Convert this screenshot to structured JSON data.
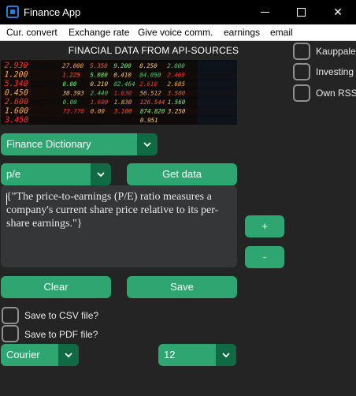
{
  "window": {
    "title": "Finance App",
    "controls": {
      "minimize": "",
      "maximize": "",
      "close": "✕"
    }
  },
  "menu": {
    "items": [
      "Cur. convert",
      "Exchange rate",
      "Give voice comm.",
      "earnings",
      "email"
    ]
  },
  "heading": "FINACIAL DATA FROM API-SOURCES",
  "board": {
    "rows": [
      [
        "2.930",
        "27.000",
        "5.350",
        "9.200",
        "8.250",
        "2.000"
      ],
      [
        "1.200",
        "1.225",
        "5.080",
        "0.410",
        "84.050",
        "2.460"
      ],
      [
        "5.340",
        "0.00",
        "0.210",
        "82.464",
        "2.610",
        "2.605"
      ],
      [
        "0.450",
        "30.393",
        "2.440",
        "1.630",
        "56.512",
        "3.500"
      ],
      [
        "2.600",
        "0.00",
        "1.600",
        "1.830",
        "126.544",
        "1.560"
      ],
      [
        "1.600",
        "73.770",
        "0.00",
        "3.100",
        "874.820",
        "3.250"
      ],
      [
        "3.450",
        "",
        "",
        "",
        "0.951",
        ""
      ]
    ]
  },
  "options": {
    "kauppalehti": "Kauppale",
    "investing": "Investing",
    "own_rss": "Own RSS"
  },
  "dictionary": {
    "selected": "Finance Dictionary"
  },
  "term": {
    "selected": "p/e"
  },
  "buttons": {
    "get_data": "Get data",
    "plus": "+",
    "minus": "-",
    "clear": "Clear",
    "save": "Save"
  },
  "output_text": "{\"The price-to-earnings (P/E) ratio measures a company's current share price relative to its per-share earnings.\"}",
  "save_options": {
    "csv": "Save to CSV file?",
    "pdf": "Save to PDF file?"
  },
  "font": {
    "selected": "Courier"
  },
  "size": {
    "selected": "12"
  },
  "colors": {
    "accent": "#2fa572",
    "accent_dark": "#106a43",
    "background": "#242424",
    "textbox": "#343638",
    "checkbox_border": "#8f8f8f"
  }
}
